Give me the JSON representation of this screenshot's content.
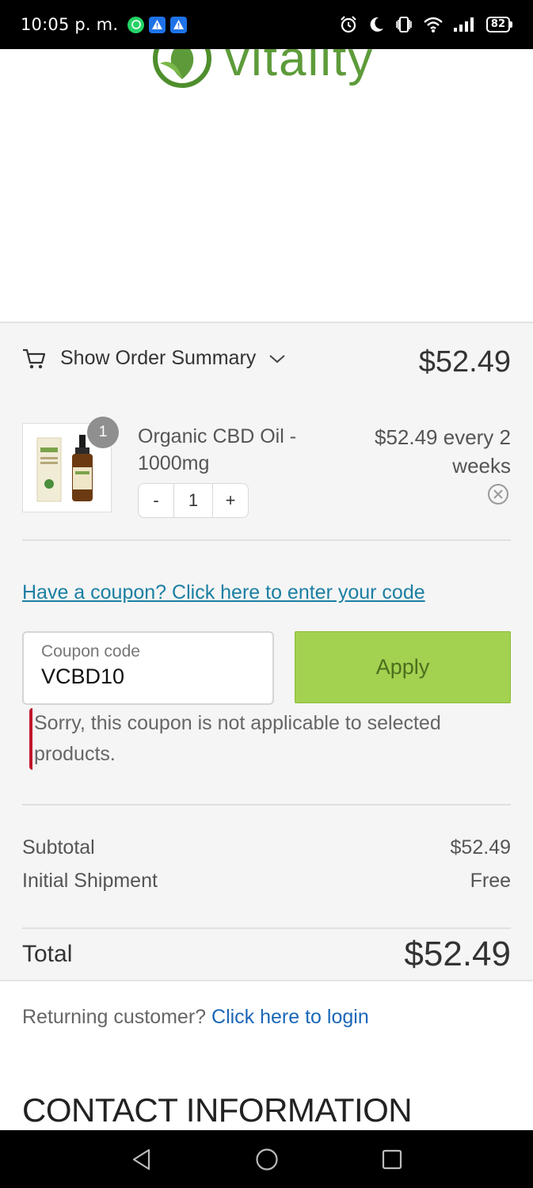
{
  "status_bar": {
    "time": "10:05 p. m.",
    "battery": "82"
  },
  "header": {
    "logo_text": "vitality"
  },
  "summary": {
    "toggle_label": "Show Order Summary",
    "total": "$52.49"
  },
  "item": {
    "quantity_badge": "1",
    "name": "Organic CBD Oil - 1000mg",
    "quantity": "1",
    "minus_label": "-",
    "plus_label": "+",
    "price": "$52.49 every 2 weeks"
  },
  "coupon": {
    "link_text": "Have a coupon? Click here to enter your code",
    "placeholder": "Coupon code",
    "value": "VCBD10",
    "apply_label": "Apply",
    "error": "Sorry, this coupon is not applicable to selected products."
  },
  "totals": {
    "subtotal_label": "Subtotal",
    "subtotal_value": "$52.49",
    "shipment_label": "Initial Shipment",
    "shipment_value": "Free",
    "total_label": "Total",
    "total_value": "$52.49"
  },
  "returning": {
    "prompt": "Returning customer?",
    "link": "Click here to login"
  },
  "contact": {
    "heading": "CONTACT INFORMATION"
  },
  "colors": {
    "accent_green": "#a3d150",
    "link_teal": "#1b7fa3",
    "link_blue": "#1a67b8",
    "error_red": "#c0172a"
  }
}
